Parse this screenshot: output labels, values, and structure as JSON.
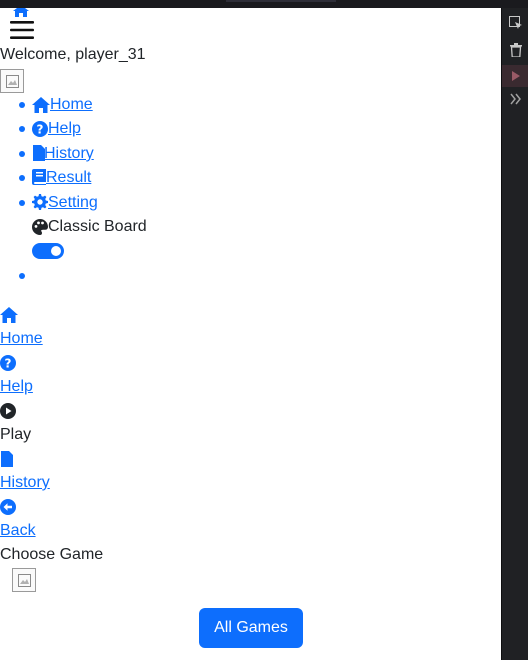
{
  "header": {
    "welcome": "Welcome, player_31"
  },
  "nav": {
    "items": [
      {
        "label": "Home",
        "icon": "home-icon"
      },
      {
        "label": "Help",
        "icon": "question-circle-icon"
      },
      {
        "label": "History",
        "icon": "file-icon"
      },
      {
        "label": "Result",
        "icon": "book-icon"
      },
      {
        "label": "Setting",
        "icon": "gear-icon"
      }
    ],
    "theme_label": "Classic Board",
    "theme_icon": "palette-icon",
    "theme_toggle_on": true
  },
  "secondary_nav": {
    "items": [
      {
        "label": "Home",
        "icon": "home-icon",
        "link": true
      },
      {
        "label": "Help",
        "icon": "question-circle-icon",
        "link": true
      },
      {
        "label": "Play",
        "icon": "play-circle-icon",
        "link": false
      },
      {
        "label": "History",
        "icon": "file-icon",
        "link": true
      },
      {
        "label": "Back",
        "icon": "arrow-left-circle-icon",
        "link": true
      }
    ]
  },
  "choose_game": {
    "label": "Choose Game",
    "button_label": "All Games"
  },
  "colors": {
    "accent": "#0d6efd",
    "text": "#212529",
    "background": "#ffffff",
    "side_panel": "#202124"
  }
}
